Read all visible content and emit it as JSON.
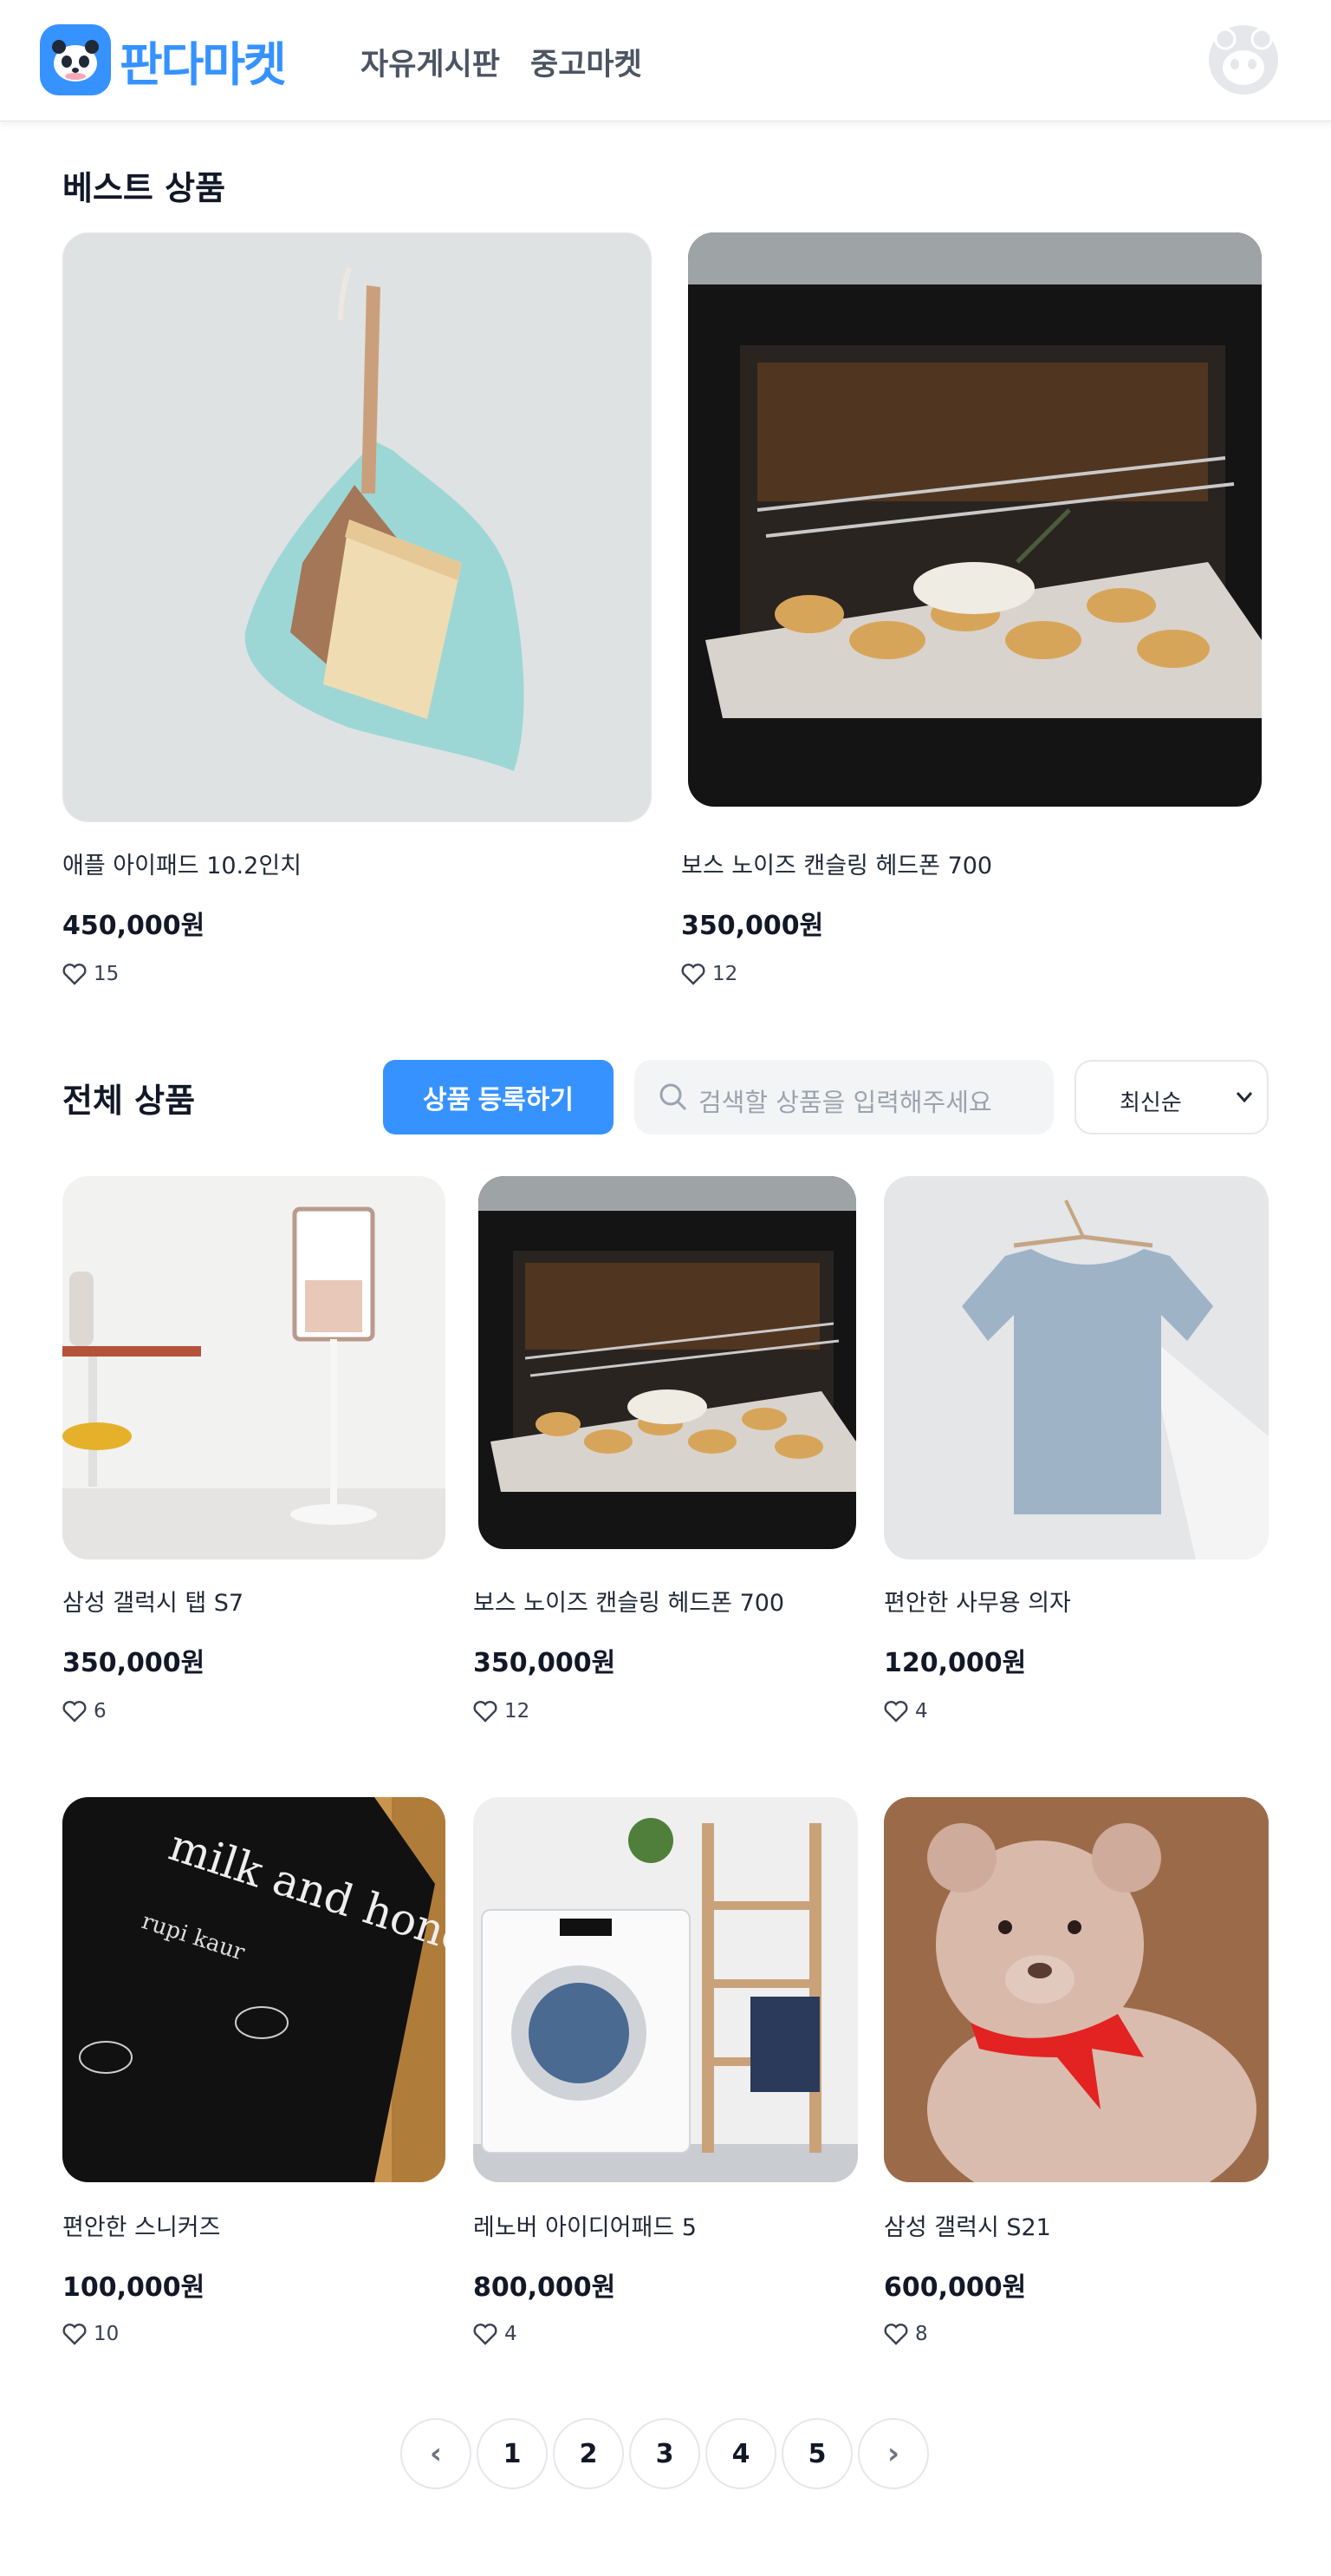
{
  "header": {
    "logo_text": "판다마켓",
    "nav": [
      "자유게시판",
      "중고마켓"
    ]
  },
  "best": {
    "title": "베스트 상품",
    "items": [
      {
        "name": "애플 아이패드 10.2인치",
        "price": "450,000원",
        "likes": "15",
        "image": "dustpan-and-brush-photo"
      },
      {
        "name": "보스 노이즈 캔슬링 헤드폰 700",
        "price": "350,000원",
        "likes": "12",
        "image": "oven-baked-bread-photo"
      }
    ]
  },
  "all": {
    "title": "전체 상품",
    "register_label": "상품 등록하기",
    "search_placeholder": "검색할 상품을 입력해주세요",
    "sort_value": "최신순",
    "items": [
      {
        "name": "삼성 갤럭시 탭 S7",
        "price": "350,000원",
        "likes": "6",
        "image": "stand-tv-room-photo"
      },
      {
        "name": "보스 노이즈 캔슬링 헤드폰 700",
        "price": "350,000원",
        "likes": "12",
        "image": "oven-baked-bread-photo"
      },
      {
        "name": "편안한 사무용 의자",
        "price": "120,000원",
        "likes": "4",
        "image": "tshirt-on-hanger-photo"
      },
      {
        "name": "편안한 스니커즈",
        "price": "100,000원",
        "likes": "10",
        "image": "milk-and-honey-book-photo"
      },
      {
        "name": "레노버 아이디어패드 5",
        "price": "800,000원",
        "likes": "4",
        "image": "washing-machine-photo"
      },
      {
        "name": "삼성 갤럭시 S21",
        "price": "600,000원",
        "likes": "8",
        "image": "teddy-bear-photo"
      }
    ]
  },
  "book_cover": {
    "title": "milk and honey",
    "author": "rupi kaur"
  },
  "pagination": {
    "pages": [
      "1",
      "2",
      "3",
      "4",
      "5"
    ],
    "prev": "‹",
    "next": "›"
  },
  "colors": {
    "accent": "#3692ff",
    "text": "#1f2937",
    "muted": "#9ca3af",
    "input_bg": "#f3f4f6"
  }
}
